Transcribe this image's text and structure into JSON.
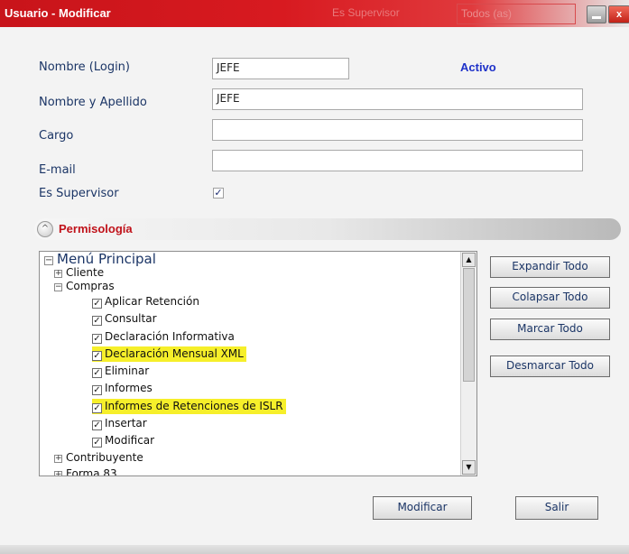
{
  "window": {
    "title": "Usuario - Modificar",
    "close_glyph": "x"
  },
  "ghost_filter": {
    "label": "Es Supervisor",
    "value": "Todos (as)"
  },
  "form": {
    "login_label": "Nombre (Login)",
    "login_value": "JEFE",
    "status_text": "Activo",
    "fullname_label": "Nombre y Apellido",
    "fullname_value": "JEFE",
    "cargo_label": "Cargo",
    "cargo_value": "",
    "email_label": "E-mail",
    "email_value": "",
    "supervisor_label": "Es Supervisor",
    "supervisor_checked": true,
    "check_glyph": "✓"
  },
  "section": {
    "title": "Permisología",
    "collapse_glyph": "^"
  },
  "tree": {
    "root": {
      "label": "Menú Principal",
      "state": "expanded"
    },
    "expanded_glyph": "−",
    "collapsed_glyph": "+",
    "checked_glyph": "✓",
    "nodes": [
      {
        "label": "Cliente",
        "state": "collapsed"
      },
      {
        "label": "Compras",
        "state": "expanded"
      },
      {
        "label": "Aplicar Retención",
        "checked": true
      },
      {
        "label": "Consultar",
        "checked": true
      },
      {
        "label": "Declaración Informativa",
        "checked": true
      },
      {
        "label": "Declaración Mensual XML",
        "checked": true,
        "highlighted": true
      },
      {
        "label": "Eliminar",
        "checked": true
      },
      {
        "label": "Informes",
        "checked": true
      },
      {
        "label": "Informes de Retenciones de ISLR",
        "checked": true,
        "highlighted": true
      },
      {
        "label": "Insertar",
        "checked": true
      },
      {
        "label": "Modificar",
        "checked": true
      },
      {
        "label": "Contribuyente",
        "state": "collapsed"
      },
      {
        "label": "Forma 83",
        "state": "collapsed"
      }
    ],
    "highlight_color": "#f6ef2a"
  },
  "side_buttons": {
    "expand_all": "Expandir Todo",
    "collapse_all": "Colapsar Todo",
    "check_all": "Marcar Todo",
    "uncheck_all": "Desmarcar Todo"
  },
  "footer_buttons": {
    "modify": "Modificar",
    "exit": "Salir"
  },
  "colors": {
    "titlebar": "#c8141a",
    "section_title": "#c0121a",
    "status": "#1f32c9",
    "label": "#1b3566"
  }
}
